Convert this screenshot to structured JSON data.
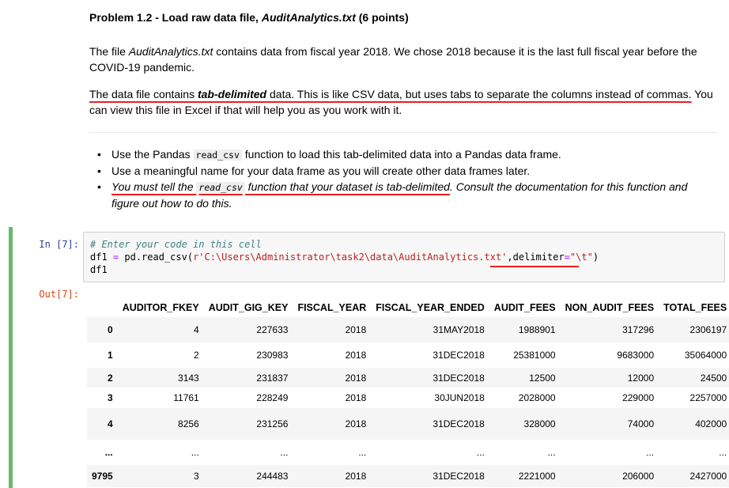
{
  "heading": {
    "prefix": "Problem 1.2 - Load raw data file, ",
    "file": "AuditAnalytics.txt",
    "suffix": " (6 points)"
  },
  "para1": {
    "a": "The file ",
    "file": "AuditAnalytics.txt",
    "b": " contains data from fiscal year 2018. We chose 2018 because it is the last full fiscal year before the COVID-19 pandemic."
  },
  "para2": {
    "a": "The data file contains ",
    "strong": "tab-delimited",
    "b": " data. This is like CSV data, but uses tabs to separate the columns instead of commas.",
    "c": " You can view this file in Excel if that will help you as you work with it."
  },
  "bullets": {
    "b1": {
      "a": "Use the Pandas ",
      "code": "read_csv",
      "b": " function to load this tab-delimited data into a Pandas data frame."
    },
    "b2": "Use a meaningful name for your data frame as you will create other data frames later.",
    "b3": {
      "a": "You must tell the ",
      "code": "read_csv",
      "b": " function that your dataset is tab-delimited",
      "c": ". Consult the documentation for this function and figure out how to do this."
    }
  },
  "cell": {
    "in_prompt": "In  [7]:",
    "out_prompt": "Out[7]:",
    "code": {
      "comment": "# Enter your code in this cell",
      "l2_a": "df1 ",
      "l2_eq": "=",
      "l2_b": " pd.read_csv(",
      "l2_str": "r'C:\\Users\\Administrator\\task2\\data\\AuditAnalytics.txt'",
      "l2_c": ",delimiter",
      "l2_eq2": "=",
      "l2_str2": "\"\\t\"",
      "l2_d": ")",
      "l3": "df1"
    }
  },
  "table": {
    "columns": [
      "",
      "AUDITOR_FKEY",
      "AUDIT_GIG_KEY",
      "FISCAL_YEAR",
      "FISCAL_YEAR_ENDED",
      "AUDIT_FEES",
      "NON_AUDIT_FEES",
      "TOTAL_FEES"
    ],
    "rows": [
      [
        "0",
        "4",
        "227633",
        "2018",
        "31MAY2018",
        "1988901",
        "317296",
        "2306197"
      ],
      [
        "1",
        "2",
        "230983",
        "2018",
        "31DEC2018",
        "25381000",
        "9683000",
        "35064000"
      ],
      [
        "2",
        "3143",
        "231837",
        "2018",
        "31DEC2018",
        "12500",
        "12000",
        "24500"
      ],
      [
        "3",
        "11761",
        "228249",
        "2018",
        "30JUN2018",
        "2028000",
        "229000",
        "2257000"
      ],
      [
        "4",
        "8256",
        "231256",
        "2018",
        "31DEC2018",
        "328000",
        "74000",
        "402000"
      ],
      [
        "...",
        "...",
        "...",
        "...",
        "...",
        "...",
        "...",
        "..."
      ],
      [
        "9795",
        "3",
        "244483",
        "2018",
        "31DEC2018",
        "2221000",
        "206000",
        "2427000"
      ]
    ]
  }
}
